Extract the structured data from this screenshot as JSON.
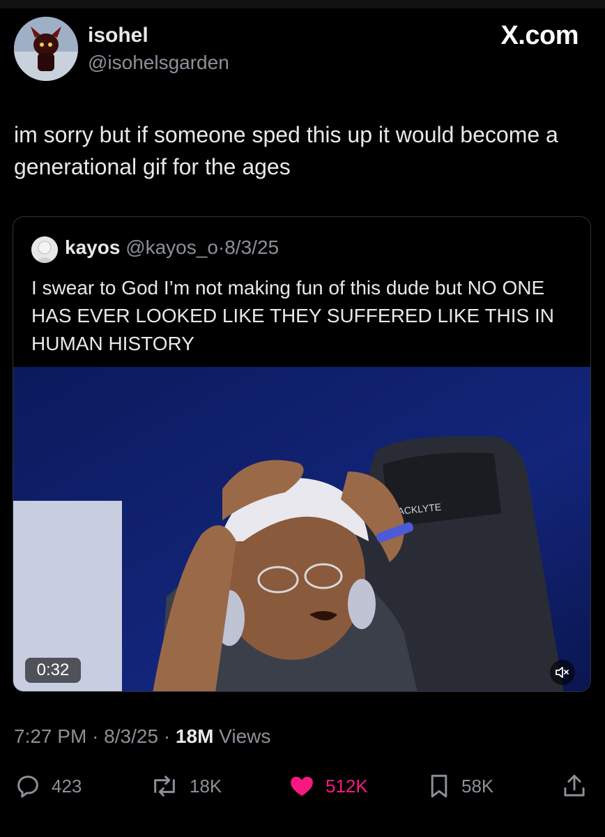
{
  "tweet": {
    "author_name": "isohel",
    "author_handle": "@isohelsgarden",
    "brand": "X.com",
    "text": "im sorry but if someone sped this up it would become a generational gif for the ages",
    "time": "7:27 PM",
    "sep1": "·",
    "date": "8/3/25",
    "sep2": "·",
    "views_count": "18M",
    "views_label": "Views"
  },
  "quoted": {
    "author_name": "kayos",
    "author_handle": "@kayos_o",
    "sep": "·",
    "date": "8/3/25",
    "text": "I swear to God I’m not making fun of this dude but NO ONE HAS EVER LOOKED LIKE THEY SUFFERED LIKE THIS IN HUMAN HISTORY",
    "video_duration": "0:32",
    "chair_brand": "ACKLYTE"
  },
  "actions": {
    "replies": "423",
    "reposts": "18K",
    "likes": "512K",
    "bookmarks": "58K"
  },
  "colors": {
    "background": "#000000",
    "text": "#e7e9ea",
    "muted": "#8b9198",
    "like": "#f91880",
    "border": "#2f3336"
  },
  "icons": [
    "reply-icon",
    "repost-icon",
    "like-icon",
    "bookmark-icon",
    "share-icon",
    "mute-icon"
  ]
}
